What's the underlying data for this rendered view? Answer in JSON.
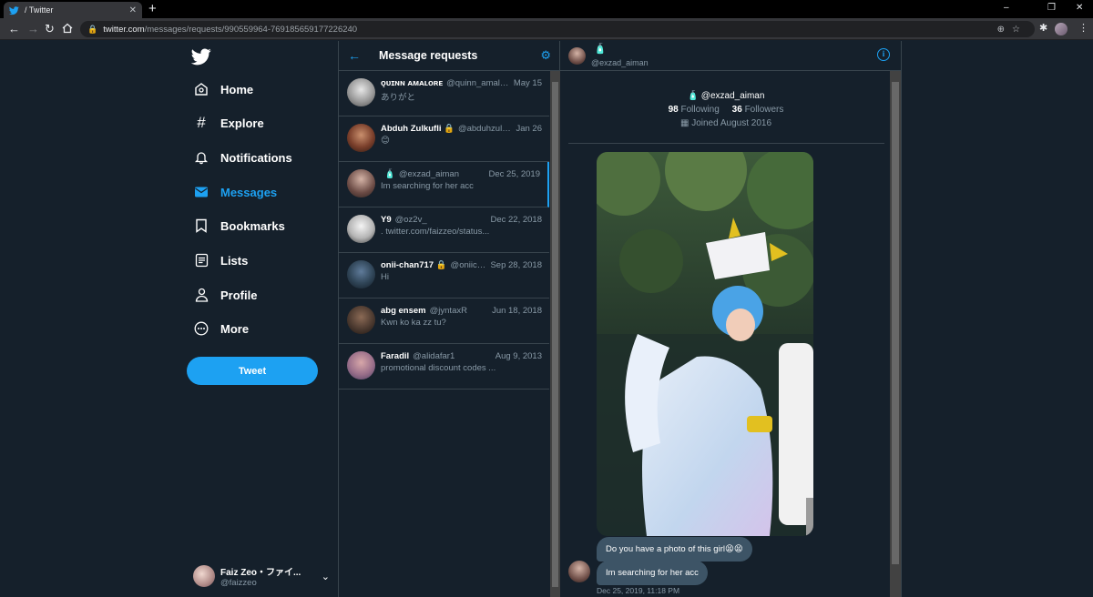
{
  "browser": {
    "tab_title": "/ Twitter",
    "new_tab": "+",
    "url_host": "twitter.com",
    "url_path": "/messages/requests/990559964-769185659177226240",
    "win_minimize": "–",
    "win_restore": "❐",
    "win_close": "✕"
  },
  "nav": {
    "items": [
      {
        "label": "Home",
        "icon": "home-icon"
      },
      {
        "label": "Explore",
        "icon": "hashtag-icon"
      },
      {
        "label": "Notifications",
        "icon": "bell-icon"
      },
      {
        "label": "Messages",
        "icon": "envelope-icon"
      },
      {
        "label": "Bookmarks",
        "icon": "bookmark-icon"
      },
      {
        "label": "Lists",
        "icon": "list-icon"
      },
      {
        "label": "Profile",
        "icon": "person-icon"
      },
      {
        "label": "More",
        "icon": "more-icon"
      }
    ],
    "active": "Messages",
    "tweet_label": "Tweet",
    "account": {
      "name": "Faiz Zeo・ファイ...",
      "handle": "@faizzeo"
    }
  },
  "requests": {
    "title": "Message requests",
    "conversations": [
      {
        "name": "ǫᴜɪɴɴ ᴀᴍᴀʟᴏʀᴇ",
        "handle": "@quinn_amalore",
        "date": "May 15",
        "preview": "ありがと"
      },
      {
        "name": "Abduh Zulkufli 🔒",
        "handle": "@abduhzulkuflii",
        "date": "Jan 26",
        "preview": "😊"
      },
      {
        "name": "",
        "handle": "@exzad_aiman",
        "date": "Dec 25, 2019",
        "preview": "Im searching for her acc"
      },
      {
        "name": "Y9",
        "handle": "@oz2v_",
        "date": "Dec 22, 2018",
        "preview": ". twitter.com/faizzeo/status..."
      },
      {
        "name": "onii-chan717 🔒",
        "handle": "@oniicha...",
        "date": "Sep 28, 2018",
        "preview": "Hi"
      },
      {
        "name": "abg ensem",
        "handle": "@jyntaxR",
        "date": "Jun 18, 2018",
        "preview": "Kwn ko ka zz tu?"
      },
      {
        "name": "Faradil",
        "handle": "@alidafar1",
        "date": "Aug 9, 2013",
        "preview": "promotional discount codes ..."
      }
    ]
  },
  "chat": {
    "handle": "@exzad_aiman",
    "following_count": "98",
    "following_label": "Following",
    "followers_count": "36",
    "followers_label": "Followers",
    "joined": "Joined August 2016",
    "messages": [
      {
        "text": "Do you have a photo of this girl😫😫"
      },
      {
        "text": "Im searching for her acc"
      }
    ],
    "timestamp": "Dec 25, 2019, 11:18 PM"
  },
  "colors": {
    "accent": "#1da1f2",
    "background": "#15202b",
    "border": "#38444d",
    "muted": "#8899a6",
    "bubble": "#3d5466"
  }
}
